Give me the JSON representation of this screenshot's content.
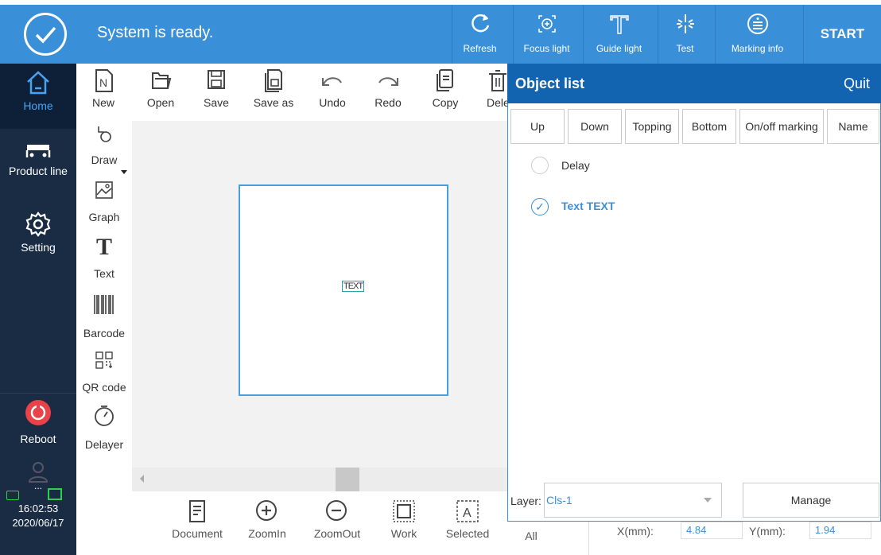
{
  "topbar": {
    "status": "System is ready.",
    "buttons": [
      {
        "label": "Refresh",
        "icon": "refresh-icon"
      },
      {
        "label": "Focus light",
        "icon": "focus-light-icon"
      },
      {
        "label": "Guide light",
        "icon": "guide-light-icon"
      },
      {
        "label": "Test",
        "icon": "test-icon"
      },
      {
        "label": "Marking info",
        "icon": "info-icon"
      }
    ],
    "start_label": "START",
    "accent": "#3a8fd9"
  },
  "leftnav": {
    "items": [
      {
        "label": "Home",
        "icon": "home-icon"
      },
      {
        "label": "Product line",
        "icon": "product-line-icon"
      },
      {
        "label": "Setting",
        "icon": "gear-icon"
      },
      {
        "label": "Reboot",
        "icon": "reboot-icon"
      }
    ],
    "more": "...",
    "time": "16:02:53",
    "date": "2020/06/17"
  },
  "toolbar": {
    "items": [
      "New",
      "Open",
      "Save",
      "Save as",
      "Undo",
      "Redo",
      "Copy",
      "Dele"
    ]
  },
  "tools": [
    "Draw",
    "Graph",
    "Text",
    "Barcode",
    "QR code",
    "Delayer"
  ],
  "canvas": {
    "object_text": "TEXT"
  },
  "bottombar": {
    "items": [
      "Document",
      "ZoomIn",
      "ZoomOut",
      "Work",
      "Selected",
      "All"
    ],
    "x_label": "X(mm):",
    "x_value": "4.84",
    "y_label": "Y(mm):",
    "y_value": "1.94"
  },
  "objlist": {
    "title": "Object list",
    "quit": "Quit",
    "buttons": [
      "Up",
      "Down",
      "Topping",
      "Bottom",
      "On/off marking",
      "Name"
    ],
    "items": [
      {
        "label": "Delay",
        "selected": false
      },
      {
        "label": "Text TEXT",
        "selected": true
      }
    ],
    "layer_label": "Layer:",
    "layer_value": "Cls-1",
    "manage": "Manage"
  }
}
